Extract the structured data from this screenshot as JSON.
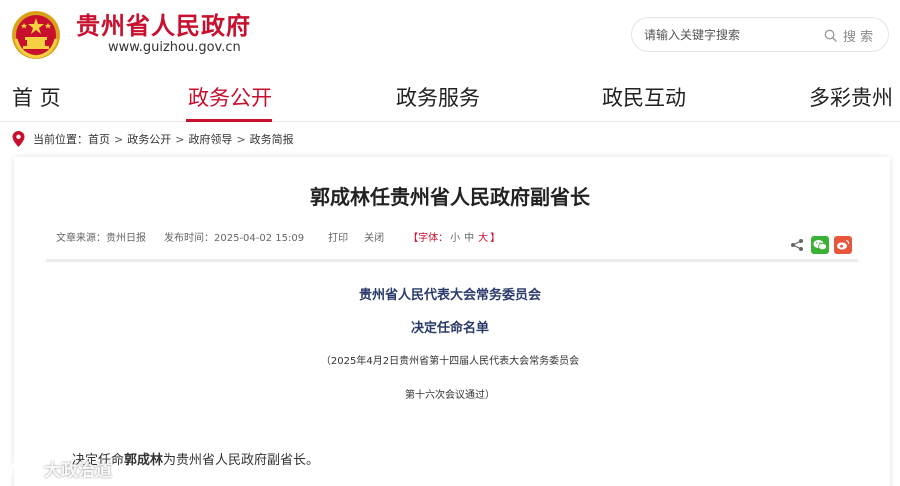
{
  "header": {
    "site_title": "贵州省人民政府",
    "site_url": "www.guizhou.gov.cn",
    "emblem_icon": "national-emblem-icon",
    "search": {
      "placeholder": "请输入关键字搜索",
      "button_label": "搜 索"
    }
  },
  "nav": {
    "items": [
      {
        "label": "首 页"
      },
      {
        "label": "政务公开"
      },
      {
        "label": "政务服务"
      },
      {
        "label": "政民互动"
      },
      {
        "label": "多彩贵州"
      }
    ],
    "active_index": 1
  },
  "breadcrumb": {
    "prefix": "当前位置：",
    "items": [
      "首页",
      "政务公开",
      "政府领导",
      "政务简报"
    ],
    "separator": ">"
  },
  "article": {
    "title": "郭成林任贵州省人民政府副省长",
    "meta": {
      "source": "文章来源：贵州日报",
      "published": "发布时间：2025-04-02 15:09",
      "print_label": "打印",
      "close_label": "关闭",
      "font_prefix": "【字体：",
      "font_small": "小",
      "font_medium": "中",
      "font_large": "大",
      "font_suffix": "】"
    },
    "share_icons": [
      "share-icon",
      "wechat-icon",
      "weibo-icon"
    ],
    "org": "贵州省人民代表大会常务委员会",
    "doc_title": "决定任命名单",
    "note_line1": "（2025年4月2日贵州省第十四届人民代表大会常务委员会",
    "note_line2": "第十六次会议通过）",
    "body": {
      "prefix": "决定任命",
      "name": "郭成林",
      "suffix": "为贵州省人民政府副省长。"
    }
  },
  "watermark": {
    "text": "大政治道"
  },
  "colors": {
    "accent": "#c8102e",
    "org_text": "#2a3a6a",
    "wechat": "#3cb034",
    "weibo": "#e6573b"
  }
}
